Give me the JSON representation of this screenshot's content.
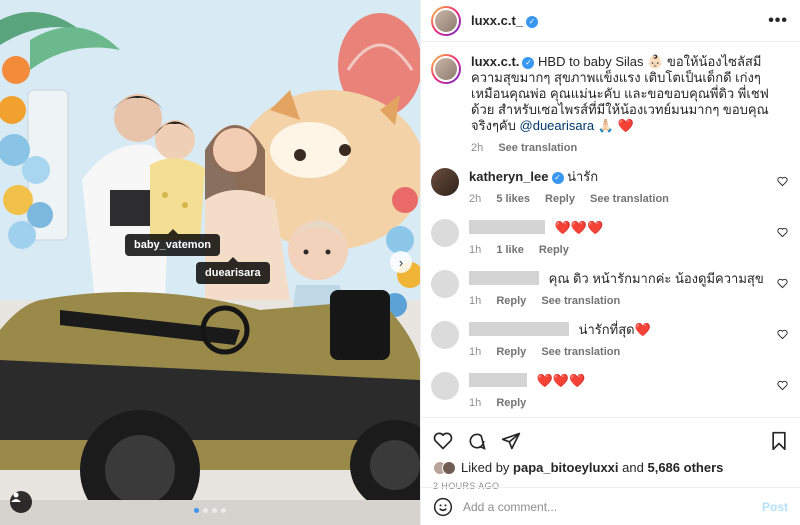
{
  "header": {
    "username": "luxx.c.t_",
    "more": "•••"
  },
  "caption": {
    "username": "luxx.c.t.",
    "text": "HBD to baby Silas 👶🏻 ขอให้น้องไซลัสมีความสุขมากๆ สุขภาพแข็งแรง เติบโตเป็นเด็กดี เก่งๆเหมือนคุณพ่อ คุณแม่นะคับ และขอขอบคุณพี่ดิว พี่เชฟด้วย สำหรับเซอไพรส์ที่มีให้น้องเวทย์มนมากๆ ขอบคุณจริงๆคับ",
    "mention": "@duearisara",
    "emoji": "🙏🏻 ❤️",
    "time": "2h",
    "see_translation": "See translation"
  },
  "comments": [
    {
      "username": "katheryn_lee",
      "text": "น่ารัก",
      "time": "2h",
      "likes": "5 likes",
      "reply": "Reply",
      "see_translation": "See translation"
    },
    {
      "username": "",
      "text": "❤️❤️❤️",
      "time": "1h",
      "likes": "1 like",
      "reply": "Reply",
      "see_translation": ""
    },
    {
      "username": "",
      "text": "คุณ ดิว หน้ารักมากค่ะ น้องดูมีความสุข",
      "time": "1h",
      "likes": "",
      "reply": "Reply",
      "see_translation": "See translation"
    },
    {
      "username": "",
      "text": "น่ารักที่สุด❤️",
      "time": "1h",
      "likes": "",
      "reply": "Reply",
      "see_translation": "See translation"
    },
    {
      "username": "",
      "text": "❤️❤️❤️",
      "time": "1h",
      "likes": "",
      "reply": "Reply",
      "see_translation": ""
    }
  ],
  "likes": {
    "prefix": "Liked by",
    "user": "papa_bitoeyluxxi",
    "mid": "and",
    "others": "5,686 others"
  },
  "timestamp": "2 HOURS AGO",
  "add_comment": {
    "placeholder": "Add a comment...",
    "post": "Post"
  },
  "photo": {
    "tags": [
      "baby_vatemon",
      "duearisara"
    ],
    "carousel": {
      "count": 4,
      "active": 1
    }
  },
  "colors": {
    "accent": "#3897f0",
    "heart": "#ed4956",
    "link": "#00376b"
  }
}
